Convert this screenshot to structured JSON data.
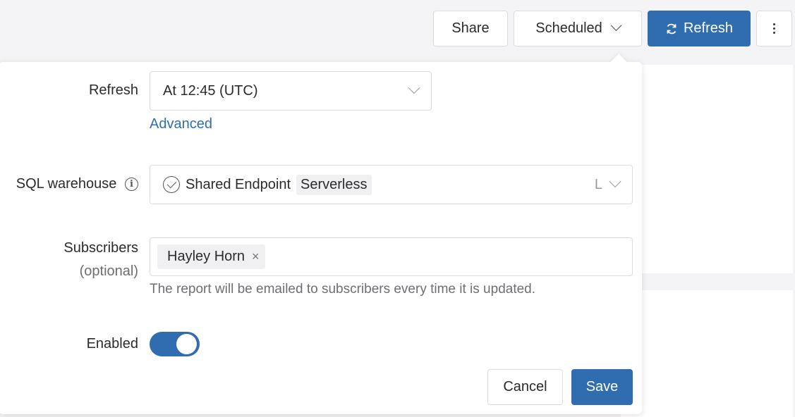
{
  "toolbar": {
    "share_label": "Share",
    "scheduled_label": "Scheduled",
    "refresh_label": "Refresh",
    "more_icon": "kebab-menu-icon"
  },
  "schedule_form": {
    "refresh": {
      "label": "Refresh",
      "value": "At 12:45 (UTC)",
      "advanced_link": "Advanced"
    },
    "sql_warehouse": {
      "label": "SQL warehouse",
      "name": "Shared Endpoint",
      "tag": "Serverless",
      "size": "L"
    },
    "subscribers": {
      "label": "Subscribers",
      "sublabel": "(optional)",
      "chips": [
        "Hayley Horn"
      ],
      "hint": "The report will be emailed to subscribers every time it is updated."
    },
    "enabled": {
      "label": "Enabled",
      "value": true
    },
    "cancel_label": "Cancel",
    "save_label": "Save"
  },
  "colors": {
    "accent": "#2f6cb0",
    "background": "#f4f4f6"
  }
}
